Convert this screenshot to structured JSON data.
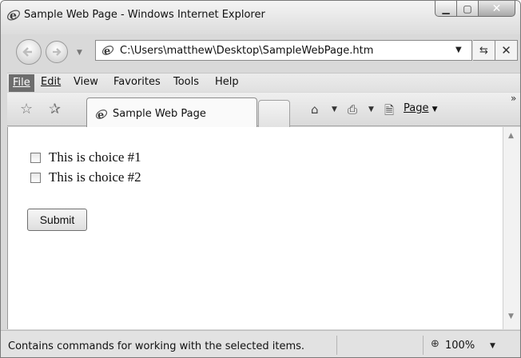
{
  "window": {
    "title": "Sample Web Page - Windows Internet Explorer",
    "icons": {
      "app": "ie-logo-icon",
      "minimize": "minimize-icon",
      "maximize": "maximize-icon",
      "close": "close-icon"
    }
  },
  "navigation": {
    "address": "C:\\Users\\matthew\\Desktop\\SampleWebPage.htm",
    "icons": {
      "back": "back-arrow-icon",
      "forward": "forward-arrow-icon",
      "refresh": "refresh-icon",
      "stop": "stop-icon"
    }
  },
  "menu": {
    "items": [
      {
        "label": "File",
        "accelerator": "F"
      },
      {
        "label": "Edit",
        "accelerator": "E"
      },
      {
        "label": "View",
        "accelerator": "V"
      },
      {
        "label": "Favorites",
        "accelerator": "a"
      },
      {
        "label": "Tools",
        "accelerator": "T"
      },
      {
        "label": "Help",
        "accelerator": "H"
      }
    ],
    "active": "File"
  },
  "commandbar": {
    "tab_title": "Sample Web Page",
    "page_label": "Page",
    "icons": {
      "favorites": "favorites-star-icon",
      "add_favorites": "add-favorites-icon",
      "home": "home-icon",
      "print": "print-icon",
      "page": "page-icon"
    }
  },
  "content": {
    "choices": [
      {
        "label": "This is choice #1",
        "checked": false
      },
      {
        "label": "This is choice #2",
        "checked": false
      }
    ],
    "submit_label": "Submit"
  },
  "status": {
    "text": "Contains commands for working with the selected items.",
    "zoom": "100%"
  }
}
